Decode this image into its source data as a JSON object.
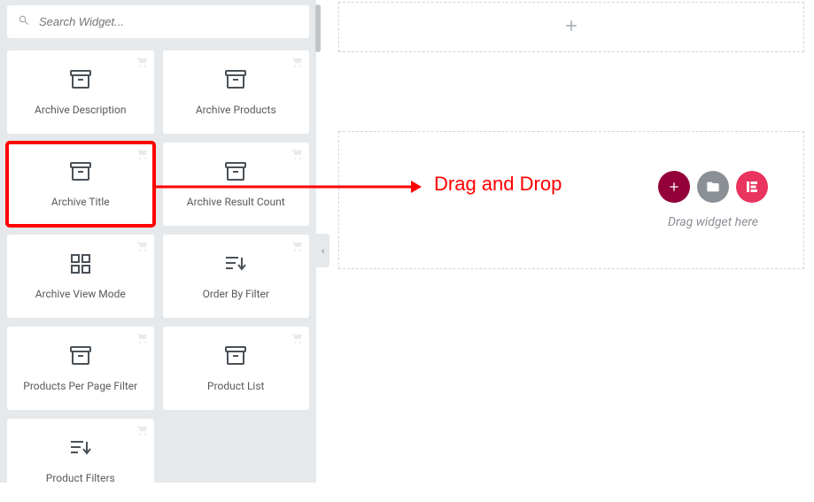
{
  "search": {
    "placeholder": "Search Widget..."
  },
  "widgets": [
    {
      "label": "Archive Description",
      "icon": "archive"
    },
    {
      "label": "Archive Products",
      "icon": "archive"
    },
    {
      "label": "Archive Title",
      "icon": "archive",
      "highlighted": true
    },
    {
      "label": "Archive Result Count",
      "icon": "archive"
    },
    {
      "label": "Archive View Mode",
      "icon": "grid"
    },
    {
      "label": "Order By Filter",
      "icon": "sort"
    },
    {
      "label": "Products Per Page Filter",
      "icon": "archive"
    },
    {
      "label": "Product List",
      "icon": "archive"
    },
    {
      "label": "Product Filters",
      "icon": "sort"
    }
  ],
  "dropzone": {
    "hint": "Drag widget here"
  },
  "annotation": {
    "text": "Drag and Drop"
  }
}
